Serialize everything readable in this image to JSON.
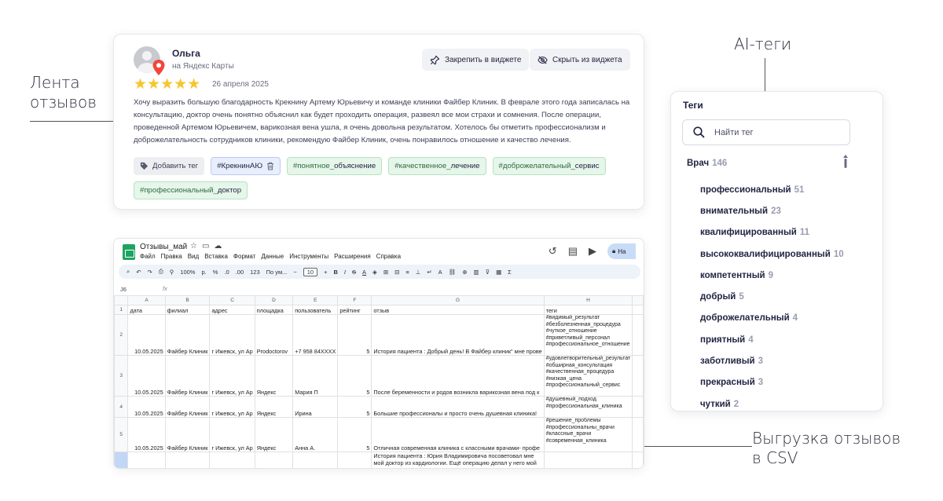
{
  "annotations": {
    "feed": [
      "Лента",
      "отзывов"
    ],
    "ai_tags": "AI-теги",
    "export": [
      "Выгрузка отзывов",
      "в CSV"
    ]
  },
  "review": {
    "author": "Ольга",
    "source": "на Яндекс Карты",
    "stars": "★★★★★",
    "rating": 5,
    "date": "26 апреля 2025",
    "pin_button": "Закрепить в виджете",
    "hide_button": "Скрыть из виджета",
    "text": "Хочу выразить большую благодарность Крекнину Артему Юрьевичу и команде клиники Файбер Клиник. В феврале этого года записалась на консультацию, доктор очень понятно объяснил как будет проходить операция, развеял все мои страхи и сомнения. После операции, проведенной Артемом Юрьевичем, варикозная вена ушла, я очень довольна результатом. Хотелось бы отметить профессионализм и доброжелательность сотрудников клиники, рекомендую Файбер Клиник, очень понравилось отношение и качество лечения.",
    "add_tag": "Добавить тег",
    "tag_blue": "#КрекнинАЮ",
    "green_tags": [
      {
        "prefix": "#понятное_",
        "word": "объяснение"
      },
      {
        "prefix": "#качественное_",
        "word": "лечение"
      },
      {
        "prefix": "#доброжелательный_",
        "word": "сервис"
      },
      {
        "prefix": "#профессиональный_",
        "word": "доктор"
      }
    ]
  },
  "sheet": {
    "title": "Отзывы_май",
    "menu": [
      "Файл",
      "Правка",
      "Вид",
      "Вставка",
      "Формат",
      "Данные",
      "Инструменты",
      "Расширения",
      "Справка"
    ],
    "access_label": "На",
    "toolbar": {
      "zoom": "100%",
      "currency": "р.",
      "percent": "%",
      "dec_minus": ".0",
      "dec_plus": ".00",
      "num": "123",
      "font": "По ум...",
      "font_size": "10"
    },
    "cell_ref": "J6",
    "fx": "fx",
    "columns": [
      "A",
      "B",
      "C",
      "D",
      "E",
      "F",
      "G",
      "H"
    ],
    "headers": [
      "дата",
      "филиал",
      "адрес",
      "площадка",
      "пользователь",
      "рейтинг",
      "отзыв",
      "теги"
    ],
    "rows": [
      {
        "n": "2",
        "date": "10.05.2025",
        "branch": "Файбер Клиник",
        "addr": "г Ижевск, ул Ар",
        "site": "Prodoctorov",
        "user": "+7 958 84XXXX",
        "rating": "5",
        "review": "История пациента : Добрый день! В Файбер клиник\" мне прове",
        "tags": "#видимый_результат\n#безболезненная_процедура\n#чуткое_отношение\n#приветливый_персонал\n#профессиональное_отношение"
      },
      {
        "n": "3",
        "date": "10.05.2025",
        "branch": "Файбер Клиник",
        "addr": "г Ижевск, ул Ар",
        "site": "Яндекс",
        "user": "Мария П",
        "rating": "5",
        "review": "После беременности и родов возникла варикозная вена под к",
        "tags": "#удовлетворительный_результат\n#обширная_консультация\n#качественная_процедура\n#низкая_цена\n#профессиональный_сервис"
      },
      {
        "n": "4",
        "date": "10.05.2025",
        "branch": "Файбер Клиник",
        "addr": "г Ижевск, ул Ар",
        "site": "Яндекс",
        "user": "Ирина",
        "rating": "5",
        "review": "Большие профессионалы и просто очень душевная клиника!",
        "tags": "#душевный_подход\n#профессиональная_клиника"
      },
      {
        "n": "5",
        "date": "10.05.2025",
        "branch": "Файбер Клиник",
        "addr": "г Ижевск, ул Ар",
        "site": "Яндекс",
        "user": "Анна А.",
        "rating": "5",
        "review": "Отличная современная клиника с классными врачами- профе",
        "tags": "#решение_проблемы\n#профессиональны_врачи\n#классные_врачи\n#современная_клиника"
      }
    ],
    "row6_review": "История пациента : Юрия Владимировича посоветовал мне мой доктор из кардиологии. Ещё операцию делал у него мой"
  },
  "tags_panel": {
    "title": "Теги",
    "search_placeholder": "Найти тег",
    "root": {
      "label": "Врач",
      "count": "146"
    },
    "children": [
      {
        "label": "профессиональный",
        "count": "51"
      },
      {
        "label": "внимательный",
        "count": "23"
      },
      {
        "label": "квалифицированный",
        "count": "11"
      },
      {
        "label": "высококвалифицированный",
        "count": "10"
      },
      {
        "label": "компетентный",
        "count": "9"
      },
      {
        "label": "добрый",
        "count": "5"
      },
      {
        "label": "доброжелательный",
        "count": "4"
      },
      {
        "label": "приятный",
        "count": "4"
      },
      {
        "label": "заботливый",
        "count": "3"
      },
      {
        "label": "прекрасный",
        "count": "3"
      },
      {
        "label": "чуткий",
        "count": "2"
      }
    ]
  }
}
